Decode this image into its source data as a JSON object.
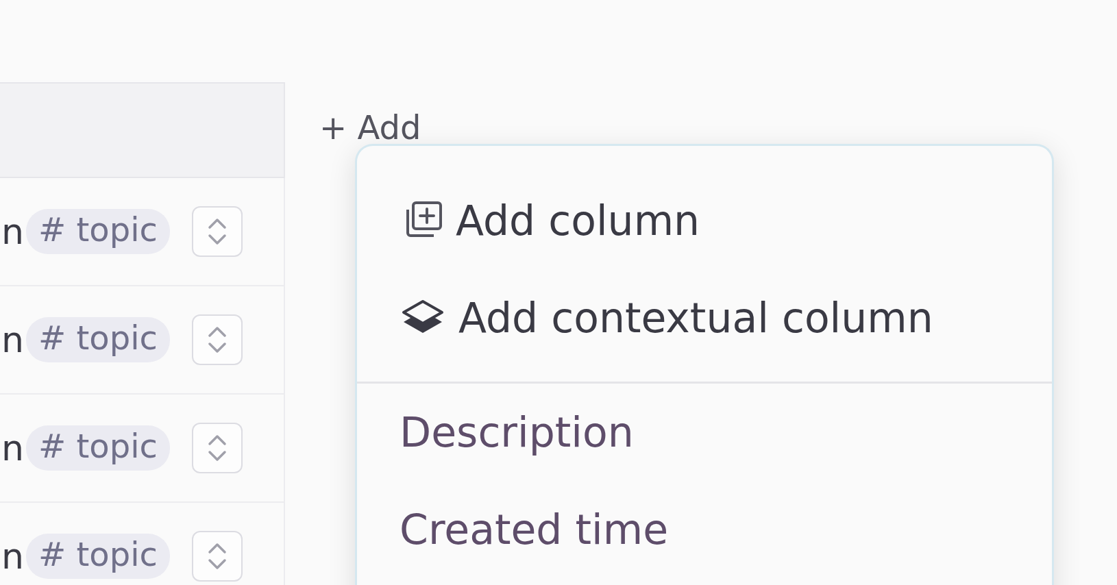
{
  "table": {
    "rows": [
      {
        "cell_1": "n",
        "tag": "# topic"
      },
      {
        "cell_1": "n",
        "tag": "# topic"
      },
      {
        "cell_1": "n",
        "tag": "# topic"
      },
      {
        "cell_1": "n",
        "tag": "# topic"
      }
    ]
  },
  "add_button": {
    "label": "+ Add"
  },
  "add_menu": {
    "items": [
      {
        "kind": "column-action",
        "label": "Add column"
      },
      {
        "kind": "context-action",
        "label": "Add contextual column"
      },
      {
        "kind": "divider"
      },
      {
        "kind": "property",
        "label": "Description"
      },
      {
        "kind": "property",
        "label": "Created time"
      }
    ]
  }
}
